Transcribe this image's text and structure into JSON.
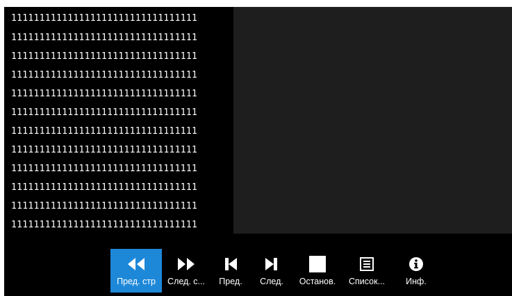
{
  "text_pane": {
    "lines": [
      "111111111111111111111111111111111",
      "111111111111111111111111111111111",
      "111111111111111111111111111111111",
      "111111111111111111111111111111111",
      "111111111111111111111111111111111",
      "111111111111111111111111111111111",
      "111111111111111111111111111111111",
      "111111111111111111111111111111111",
      "111111111111111111111111111111111",
      "111111111111111111111111111111111",
      "111111111111111111111111111111111",
      "111111111111111111111111111111111"
    ]
  },
  "toolbar": {
    "buttons": [
      {
        "label": "Пред. стр",
        "icon": "rewind-icon",
        "active": true
      },
      {
        "label": "След. с...",
        "icon": "fast-forward-icon",
        "active": false
      },
      {
        "label": "Пред.",
        "icon": "skip-previous-icon",
        "active": false
      },
      {
        "label": "След.",
        "icon": "skip-next-icon",
        "active": false
      },
      {
        "label": "Останов.",
        "icon": "stop-icon",
        "active": false
      },
      {
        "label": "Список...",
        "icon": "list-icon",
        "active": false
      },
      {
        "label": "Инф.",
        "icon": "info-icon",
        "active": false
      }
    ]
  },
  "colors": {
    "active_accent": "#1e88d8",
    "background": "#000000",
    "preview_background": "#1e1e1e",
    "text": "#ffffff"
  }
}
